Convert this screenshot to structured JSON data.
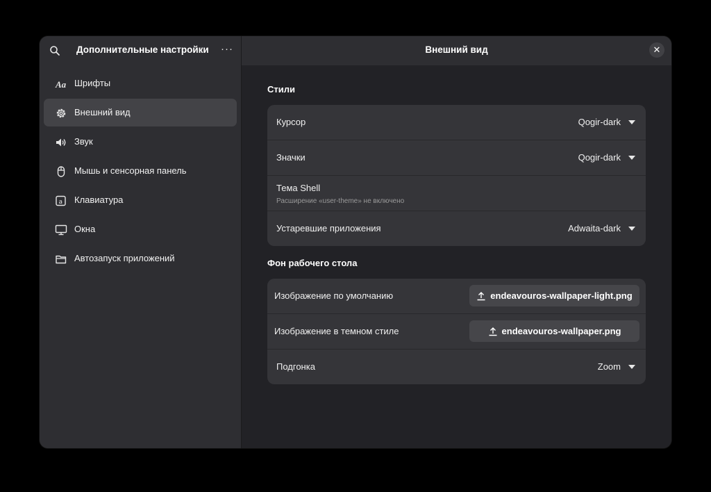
{
  "sidebar": {
    "title": "Дополнительные настройки",
    "menu_label": "···",
    "items": [
      {
        "label": "Шрифты",
        "icon": "fonts-icon"
      },
      {
        "label": "Внешний вид",
        "icon": "appearance-gear-icon",
        "active": true
      },
      {
        "label": "Звук",
        "icon": "speaker-icon"
      },
      {
        "label": "Мышь и сенсорная панель",
        "icon": "mouse-icon"
      },
      {
        "label": "Клавиатура",
        "icon": "keyboard-icon"
      },
      {
        "label": "Окна",
        "icon": "monitor-icon"
      },
      {
        "label": "Автозапуск приложений",
        "icon": "folder-icon"
      }
    ]
  },
  "main": {
    "title": "Внешний вид",
    "close_label": "✕",
    "styles": {
      "title": "Стили",
      "rows": [
        {
          "label": "Курсор",
          "value": "Qogir-dark"
        },
        {
          "label": "Значки",
          "value": "Qogir-dark"
        },
        {
          "label": "Тема Shell",
          "subtitle": "Расширение «user-theme» не включено"
        },
        {
          "label": "Устаревшие приложения",
          "value": "Adwaita-dark"
        }
      ]
    },
    "background": {
      "title": "Фон рабочего стола",
      "rows": [
        {
          "label": "Изображение по умолчанию",
          "file": "endeavouros-wallpaper-light.png"
        },
        {
          "label": "Изображение в темном стиле",
          "file": "endeavouros-wallpaper.png"
        },
        {
          "label": "Подгонка",
          "value": "Zoom"
        }
      ]
    }
  },
  "colors": {
    "window_bg": "#222226",
    "sidebar_bg": "#2e2e32",
    "row_bg": "#353539",
    "active_item_bg": "#434347",
    "button_bg": "#46464a"
  }
}
